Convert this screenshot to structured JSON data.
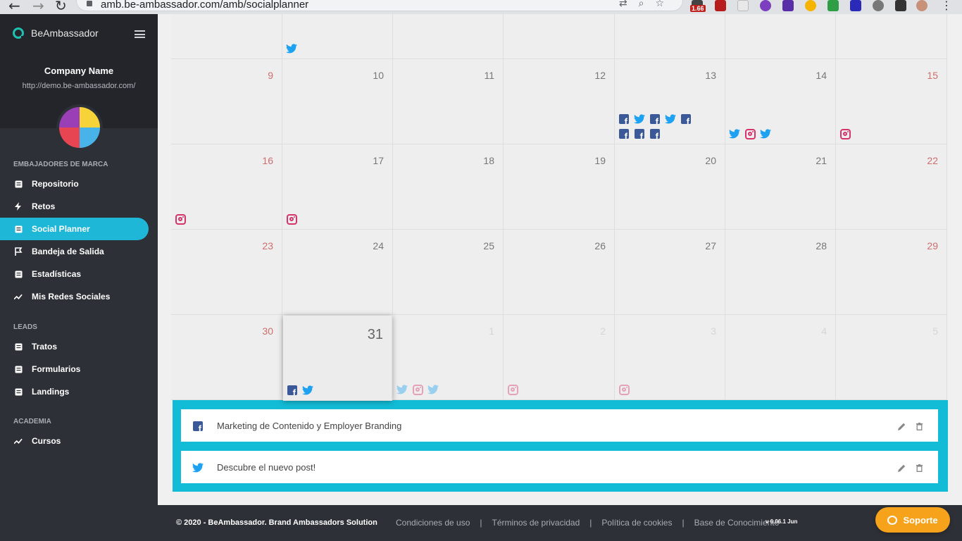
{
  "browser": {
    "url": "amb.be-ambassador.com/amb/socialplanner",
    "ext_badge": "1.66"
  },
  "sidebar": {
    "brand": "BeAmbassador",
    "company_name": "Company Name",
    "company_url": "http://demo.be-ambassador.com/",
    "sections": [
      {
        "label": "EMBAJADORES DE MARCA",
        "items": [
          {
            "label": "Repositorio",
            "icon": "list-icon"
          },
          {
            "label": "Retos",
            "icon": "bolt-icon"
          },
          {
            "label": "Social Planner",
            "icon": "calendar-icon",
            "active": true
          },
          {
            "label": "Bandeja de Salida",
            "icon": "flag-icon"
          },
          {
            "label": "Estadísticas",
            "icon": "chart-icon"
          },
          {
            "label": "Mis Redes Sociales",
            "icon": "trend-icon"
          }
        ]
      },
      {
        "label": "LEADS",
        "items": [
          {
            "label": "Tratos",
            "icon": "id-card-icon"
          },
          {
            "label": "Formularios",
            "icon": "form-icon"
          },
          {
            "label": "Landings",
            "icon": "landing-icon"
          }
        ]
      },
      {
        "label": "ACADEMIA",
        "items": [
          {
            "label": "Cursos",
            "icon": "trend-icon"
          }
        ]
      }
    ]
  },
  "calendar": {
    "weeks": [
      [
        {
          "day": "",
          "icons": []
        },
        {
          "day": "",
          "icons": [
            "tw"
          ]
        },
        {
          "day": "",
          "icons": []
        },
        {
          "day": "",
          "icons": []
        },
        {
          "day": "",
          "icons": []
        },
        {
          "day": "",
          "icons": []
        },
        {
          "day": "",
          "icons": []
        }
      ],
      [
        {
          "day": "9",
          "weekend": true,
          "icons": []
        },
        {
          "day": "10",
          "icons": []
        },
        {
          "day": "11",
          "icons": []
        },
        {
          "day": "12",
          "icons": []
        },
        {
          "day": "13",
          "icons": [
            "fb",
            "tw",
            "fb",
            "tw",
            "fb",
            "fb",
            "fb",
            "fb"
          ]
        },
        {
          "day": "14",
          "icons": [
            "tw",
            "ig",
            "tw"
          ]
        },
        {
          "day": "15",
          "weekend": true,
          "icons": [
            "ig"
          ]
        }
      ],
      [
        {
          "day": "16",
          "weekend": true,
          "icons": [
            "ig"
          ]
        },
        {
          "day": "17",
          "icons": [
            "ig"
          ]
        },
        {
          "day": "18",
          "icons": []
        },
        {
          "day": "19",
          "icons": []
        },
        {
          "day": "20",
          "icons": []
        },
        {
          "day": "21",
          "icons": []
        },
        {
          "day": "22",
          "weekend": true,
          "icons": []
        }
      ],
      [
        {
          "day": "23",
          "weekend": true,
          "icons": []
        },
        {
          "day": "24",
          "icons": []
        },
        {
          "day": "25",
          "icons": []
        },
        {
          "day": "26",
          "icons": []
        },
        {
          "day": "27",
          "icons": []
        },
        {
          "day": "28",
          "icons": []
        },
        {
          "day": "29",
          "weekend": true,
          "icons": []
        }
      ],
      [
        {
          "day": "30",
          "weekend": true,
          "icons": []
        },
        {
          "day": "31",
          "today": true,
          "icons": [
            "fb",
            "tw"
          ]
        },
        {
          "day": "1",
          "faded": true,
          "icons": [
            "tw",
            "ig",
            "tw"
          ]
        },
        {
          "day": "2",
          "faded": true,
          "icons": [
            "ig"
          ]
        },
        {
          "day": "3",
          "faded": true,
          "icons": [
            "ig"
          ]
        },
        {
          "day": "4",
          "faded": true,
          "icons": []
        },
        {
          "day": "5",
          "faded": true,
          "icons": []
        }
      ]
    ]
  },
  "posts": [
    {
      "network": "fb",
      "title": "Marketing de Contenido y Employer Branding"
    },
    {
      "network": "tw",
      "title": "Descubre el nuevo post!"
    }
  ],
  "footer": {
    "copyright": "© 2020 - BeAmbassador. Brand Ambassadors Solution",
    "links": [
      "Condiciones de uso",
      "Términos de privacidad",
      "Política de cookies",
      "Base de Conocimiento"
    ],
    "version": "v 6.06.1 Jun",
    "support_label": "Soporte"
  },
  "colors": {
    "sidebar_bg": "#2d3037",
    "accent": "#1fb7d8",
    "facebook": "#3b5998",
    "twitter": "#1da1f2",
    "instagram": "#d6336c",
    "support": "#f7a21b"
  }
}
